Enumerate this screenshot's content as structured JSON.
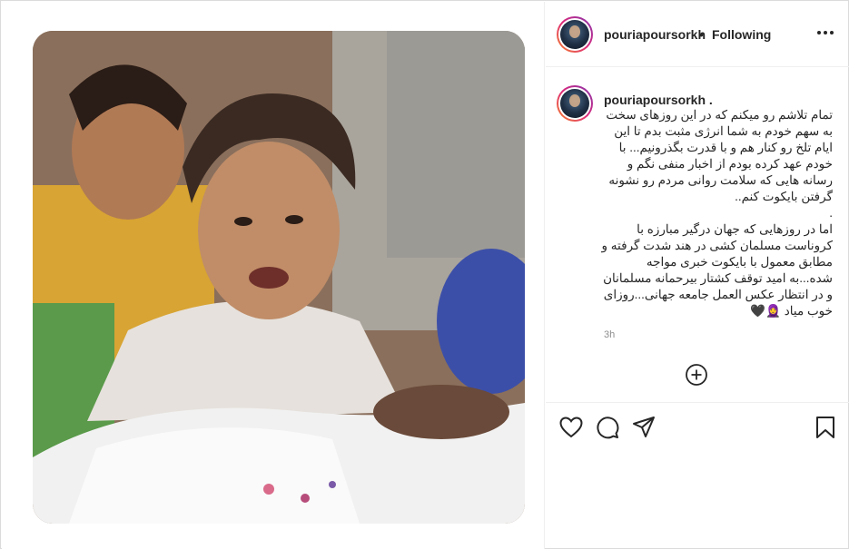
{
  "post": {
    "username": "pouriapoursorkh",
    "separator": "•",
    "follow_status": "Following",
    "caption_username": "pouriapoursorkh .",
    "caption_text": "تمام تلاشم رو میکنم که در این روزهای سخت به سهم خودم به شما انرژی مثبت بدم تا این ایام تلخ رو کنار هم و با قدرت بگذرونیم... با خودم عهد کرده بودم از اخبار منفی نگم و رسانه هایی که سلامت روانی مردم رو نشونه گرفتن بایکوت کنم..\n.\nاما در روزهایی که جهان درگیر مبارزه با کروناست مسلمان کشی در هند شدت گرفته و مطابق معمول با بایکوت خبری مواجه شده...به امید توقف کشتار بیرحمانه مسلمانان و در انتظار عکس العمل جامعه جهانی...روزای خوب میاد 🧕🖤",
    "time_ago": "3h"
  },
  "icons": {
    "more": "more-options-icon",
    "add_comment": "add-circle-icon",
    "like": "heart-icon",
    "comment": "comment-icon",
    "share": "paper-plane-icon",
    "save": "bookmark-icon"
  },
  "colors": {
    "text": "#262626",
    "muted": "#8e8e8e",
    "border": "#efefef"
  }
}
